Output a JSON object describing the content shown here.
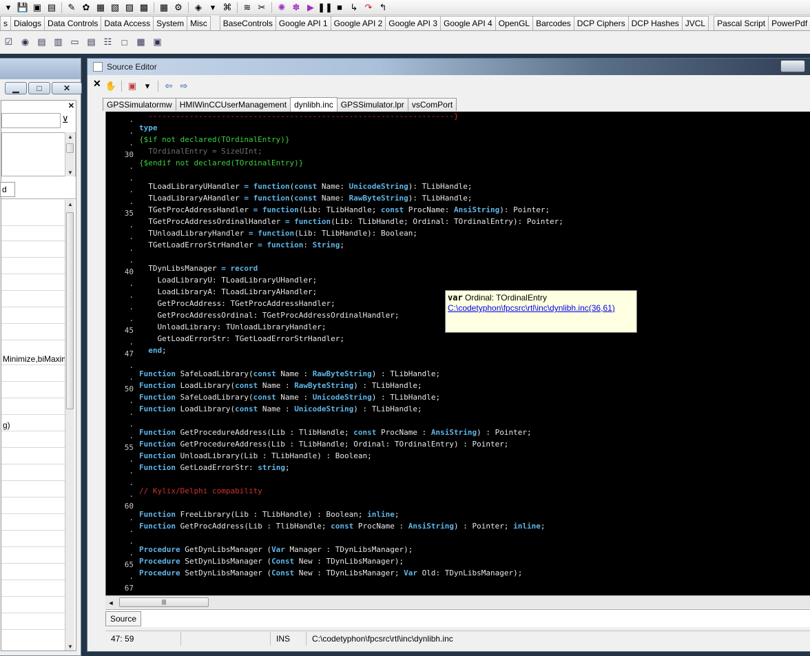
{
  "toolbar": {
    "icons": [
      "open-icon",
      "save-icon",
      "save-all-icon",
      "new-form-icon",
      "toggle-icon",
      "view-units-icon",
      "view-forms-icon",
      "new-unit-icon",
      "open-file-icon",
      "build-icon",
      "run-icon",
      "pause-icon",
      "stop-icon",
      "step-into-icon",
      "step-over-icon"
    ]
  },
  "palette": {
    "tabs": [
      "s",
      "Dialogs",
      "Data Controls",
      "Data Access",
      "System",
      "Misc",
      "BaseControls",
      "Google API 1",
      "Google API 2",
      "Google API 3",
      "Google API 4",
      "OpenGL",
      "Barcodes",
      "DCP Ciphers",
      "DCP Hashes",
      "JVCL",
      "Pascal Script",
      "PowerPdf"
    ],
    "components": [
      "☑",
      "◉",
      "▤",
      "▥",
      "▭",
      "▤",
      "☷",
      "□",
      "▦",
      "▣"
    ]
  },
  "inspector": {
    "minimize_label": "▁",
    "restore_label": "□",
    "close_label": "✕",
    "panel_close": "✕",
    "tab_label": "d",
    "row_minimize": "Minimize,biMaxim",
    "row_g": "g)"
  },
  "editor": {
    "title": "Source Editor",
    "close_x": "✕",
    "tabs": [
      "GPSSimulatormw",
      "HMIWinCCUserManagement",
      "dynlibh.inc",
      "GPSSimulator.lpr",
      "vsComPort"
    ],
    "active_tab": 2,
    "hint": {
      "keyword": "var",
      "text": " Ordinal: TOrdinalEntry",
      "link": "C:\\codetyphon\\fpcsrc\\rtl\\inc\\dynlibh.inc(36,61)"
    },
    "hscroll_grip": "|||",
    "message_tab": "Source",
    "status": {
      "position": "47: 59",
      "blank": "",
      "mode": "INS",
      "path": "C:\\codetyphon\\fpcsrc\\rtl\\inc\\dynlibh.inc"
    }
  },
  "code": {
    "gutter": [
      ".",
      ".",
      ".",
      "30",
      ".",
      ".",
      ".",
      ".",
      "35",
      ".",
      ".",
      ".",
      ".",
      "40",
      ".",
      ".",
      ".",
      ".",
      "45",
      ".",
      "47",
      ".",
      ".",
      "50",
      ".",
      ".",
      ".",
      ".",
      "55",
      ".",
      ".",
      ".",
      ".",
      "60",
      ".",
      ".",
      ".",
      ".",
      "65",
      ".",
      "67"
    ],
    "lines": [
      [
        [
          "cm",
          "  -------------------------------------------------------------------}"
        ]
      ],
      [
        [
          "kw",
          "type"
        ]
      ],
      [
        [
          "dir",
          "{$if not declared(TOrdinalEntry)}"
        ]
      ],
      [
        [
          "dim",
          "  TOrdinalEntry = SizeUInt;"
        ]
      ],
      [
        [
          "dir",
          "{$endif not declared(TOrdinalEntry)}"
        ]
      ],
      [
        [
          "pl",
          ""
        ]
      ],
      [
        [
          "pl",
          "  TLoadLibraryUHandler "
        ],
        [
          "kw",
          "= function"
        ],
        [
          "pl",
          "("
        ],
        [
          "kw",
          "const"
        ],
        [
          "pl",
          " Name: "
        ],
        [
          "typ",
          "UnicodeString"
        ],
        [
          "pl",
          "): TLibHandle;"
        ]
      ],
      [
        [
          "pl",
          "  TLoadLibraryAHandler "
        ],
        [
          "kw",
          "= function"
        ],
        [
          "pl",
          "("
        ],
        [
          "kw",
          "const"
        ],
        [
          "pl",
          " Name: "
        ],
        [
          "typ",
          "RawByteString"
        ],
        [
          "pl",
          "): TLibHandle;"
        ]
      ],
      [
        [
          "pl",
          "  TGetProcAddressHandler "
        ],
        [
          "kw",
          "= function"
        ],
        [
          "pl",
          "(Lib: TLibHandle; "
        ],
        [
          "kw",
          "const"
        ],
        [
          "pl",
          " ProcName: "
        ],
        [
          "typ",
          "AnsiString"
        ],
        [
          "pl",
          "): Pointer;"
        ]
      ],
      [
        [
          "pl",
          "  TGetProcAddressOrdinalHandler "
        ],
        [
          "kw",
          "= function"
        ],
        [
          "pl",
          "(Lib: TLibHandle; Ordinal: TOrdinalEntry): Pointer;"
        ]
      ],
      [
        [
          "pl",
          "  TUnloadLibraryHandler "
        ],
        [
          "kw",
          "= function"
        ],
        [
          "pl",
          "(Lib: TLibHandle): Boolean;"
        ]
      ],
      [
        [
          "pl",
          "  TGetLoadErrorStrHandler "
        ],
        [
          "kw",
          "= function"
        ],
        [
          "pl",
          ": "
        ],
        [
          "typ",
          "String"
        ],
        [
          "pl",
          ";"
        ]
      ],
      [
        [
          "pl",
          ""
        ]
      ],
      [
        [
          "pl",
          "  TDynLibsManager "
        ],
        [
          "kw",
          "= record"
        ]
      ],
      [
        [
          "pl",
          "    LoadLibraryU: TLoadLibraryUHandler;"
        ]
      ],
      [
        [
          "pl",
          "    LoadLibraryA: TLoadLibraryAHandler;"
        ]
      ],
      [
        [
          "pl",
          "    GetProcAddress: TGetProcAddressHandler;"
        ]
      ],
      [
        [
          "pl",
          "    GetProcAddressOrdinal: TGetProcAddressOrdinalHandler;"
        ]
      ],
      [
        [
          "pl",
          "    UnloadLibrary: TUnloadLibraryHandler;"
        ]
      ],
      [
        [
          "pl",
          "    GetLoadErrorStr: TGetLoadErrorStrHandler;"
        ]
      ],
      [
        [
          "kw",
          "  end"
        ],
        [
          "pl",
          ";"
        ]
      ],
      [
        [
          "pl",
          ""
        ]
      ],
      [
        [
          "kw",
          "Function"
        ],
        [
          "pl",
          " SafeLoadLibrary("
        ],
        [
          "kw",
          "const"
        ],
        [
          "pl",
          " Name : "
        ],
        [
          "typ",
          "RawByteString"
        ],
        [
          "pl",
          ") : TLibHandle;"
        ]
      ],
      [
        [
          "kw",
          "Function"
        ],
        [
          "pl",
          " LoadLibrary("
        ],
        [
          "kw",
          "const"
        ],
        [
          "pl",
          " Name : "
        ],
        [
          "typ",
          "RawByteString"
        ],
        [
          "pl",
          ") : TLibHandle;"
        ]
      ],
      [
        [
          "kw",
          "Function"
        ],
        [
          "pl",
          " SafeLoadLibrary("
        ],
        [
          "kw",
          "const"
        ],
        [
          "pl",
          " Name : "
        ],
        [
          "typ",
          "UnicodeString"
        ],
        [
          "pl",
          ") : TLibHandle;"
        ]
      ],
      [
        [
          "kw",
          "Function"
        ],
        [
          "pl",
          " LoadLibrary("
        ],
        [
          "kw",
          "const"
        ],
        [
          "pl",
          " Name : "
        ],
        [
          "typ",
          "UnicodeString"
        ],
        [
          "pl",
          ") : TLibHandle;"
        ]
      ],
      [
        [
          "pl",
          ""
        ]
      ],
      [
        [
          "kw",
          "Function"
        ],
        [
          "pl",
          " GetProcedureAddress(Lib : TlibHandle; "
        ],
        [
          "kw",
          "const"
        ],
        [
          "pl",
          " ProcName : "
        ],
        [
          "typ",
          "AnsiString"
        ],
        [
          "pl",
          ") : Pointer;"
        ]
      ],
      [
        [
          "kw",
          "Function"
        ],
        [
          "pl",
          " GetProcedureAddress(Lib : TLibHandle; Ordinal: TOrdinalEntry) : Pointer;"
        ]
      ],
      [
        [
          "kw",
          "Function"
        ],
        [
          "pl",
          " UnloadLibrary(Lib : TLibHandle) : Boolean;"
        ]
      ],
      [
        [
          "kw",
          "Function"
        ],
        [
          "pl",
          " GetLoadErrorStr: "
        ],
        [
          "typ",
          "string"
        ],
        [
          "pl",
          ";"
        ]
      ],
      [
        [
          "pl",
          ""
        ]
      ],
      [
        [
          "cm",
          "// Kylix/Delphi compability"
        ]
      ],
      [
        [
          "pl",
          ""
        ]
      ],
      [
        [
          "kw",
          "Function"
        ],
        [
          "pl",
          " FreeLibrary(Lib : TLibHandle) : Boolean; "
        ],
        [
          "kw",
          "inline"
        ],
        [
          "pl",
          ";"
        ]
      ],
      [
        [
          "kw",
          "Function"
        ],
        [
          "pl",
          " GetProcAddress(Lib : TlibHandle; "
        ],
        [
          "kw",
          "const"
        ],
        [
          "pl",
          " ProcName : "
        ],
        [
          "typ",
          "AnsiString"
        ],
        [
          "pl",
          ") : Pointer; "
        ],
        [
          "kw",
          "inline"
        ],
        [
          "pl",
          ";"
        ]
      ],
      [
        [
          "pl",
          ""
        ]
      ],
      [
        [
          "kw",
          "Procedure"
        ],
        [
          "pl",
          " GetDynLibsManager ("
        ],
        [
          "kw",
          "Var"
        ],
        [
          "pl",
          " Manager : TDynLibsManager);"
        ]
      ],
      [
        [
          "kw",
          "Procedure"
        ],
        [
          "pl",
          " SetDynLibsManager ("
        ],
        [
          "kw",
          "Const"
        ],
        [
          "pl",
          " New : TDynLibsManager);"
        ]
      ],
      [
        [
          "kw",
          "Procedure"
        ],
        [
          "pl",
          " SetDynLibsManager ("
        ],
        [
          "kw",
          "Const"
        ],
        [
          "pl",
          " New : TDynLibsManager; "
        ],
        [
          "kw",
          "Var"
        ],
        [
          "pl",
          " Old: TDynLibsManager);"
        ]
      ],
      [
        [
          "pl",
          ""
        ]
      ]
    ]
  }
}
